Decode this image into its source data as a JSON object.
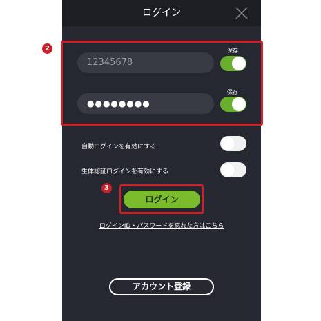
{
  "header": {
    "title": "ログイン",
    "close_icon": "close-icon"
  },
  "credentials": {
    "id_value": "12345678",
    "password_value": "●●●●●●●●",
    "save_label": "保存",
    "id_save_on": true,
    "password_save_on": true
  },
  "options": {
    "auto_login_label": "自動ログインを有効にする",
    "biometric_login_label": "生体認証ログインを有効にする",
    "auto_login_on": false,
    "biometric_login_on": false
  },
  "actions": {
    "login_label": "ログイン",
    "forgot_link": "ログインID・パスワードを忘れた方はこちら",
    "register_label": "アカウント登録"
  },
  "annotations": [
    {
      "number": "2"
    },
    {
      "number": "3"
    }
  ],
  "colors": {
    "background": "#252830",
    "accent_green": "#7bbc2c",
    "highlight_red": "#d0202a"
  }
}
